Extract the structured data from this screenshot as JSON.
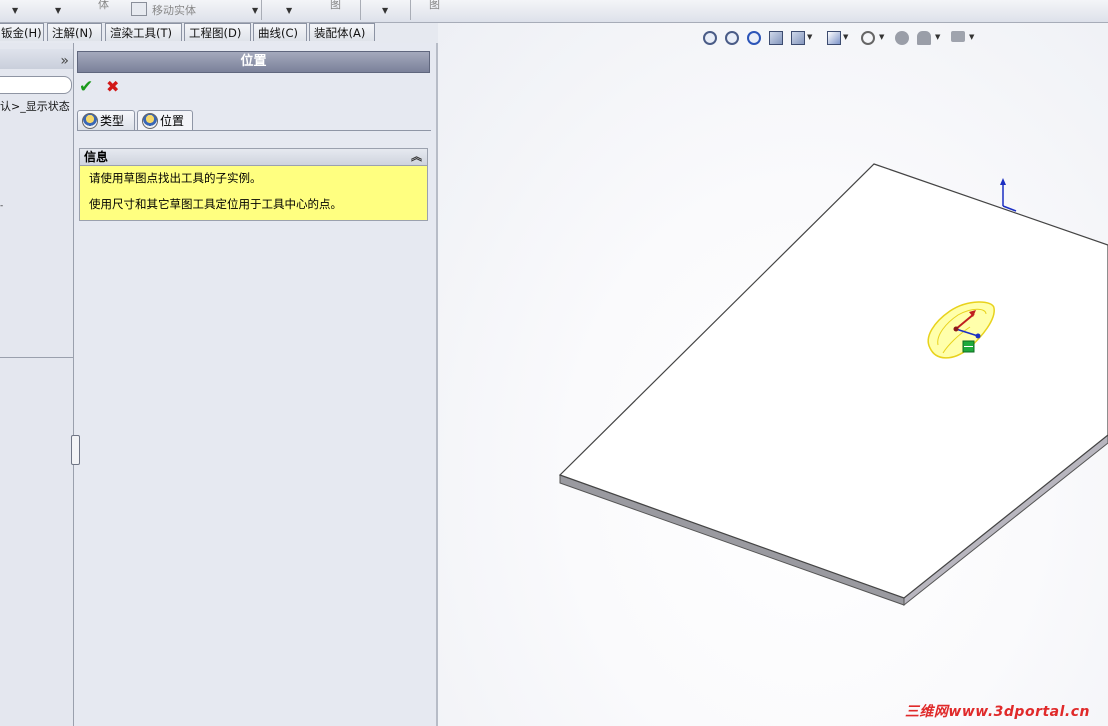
{
  "toolbar": {
    "body_label": "体",
    "move_body_label": "移动实体",
    "image_label": "图"
  },
  "command_tabs": [
    "钣金(H)",
    "注解(N)",
    "渲染工具(T)",
    "工程图(D)",
    "曲线(C)",
    "装配体(A)"
  ],
  "feature_tree": {
    "expand_chevron": "»",
    "config_text": "认>_显示状态",
    "dash": "-"
  },
  "property_manager": {
    "title": "位置",
    "ok_symbol": "✔",
    "cancel_symbol": "✖",
    "tabs": [
      {
        "label": "类型",
        "icon": "hole-wizard-icon",
        "active": false
      },
      {
        "label": "位置",
        "icon": "hole-wizard-icon",
        "active": true
      }
    ],
    "info_group": {
      "header": "信息",
      "collapse_symbol": "︽",
      "bg_color": "#ffff80",
      "lines": [
        "请使用草图点找出工具的子实例。",
        "使用尺寸和其它草图工具定位用于工具中心的点。"
      ]
    }
  },
  "view_toolbar": {
    "icons": [
      "zoom-to-fit-icon",
      "zoom-to-area-icon",
      "previous-view-icon",
      "section-view-icon",
      "view-orientation-icon",
      "display-style-icon",
      "hide-show-items-icon",
      "edit-appearance-icon",
      "apply-scene-icon",
      "view-settings-icon"
    ]
  },
  "watermark": "三维网www.3dportal.cn",
  "colors": {
    "accent": "#7b819a",
    "tool_preview": "#ffff66",
    "triad_x": "#c01f1f",
    "triad_y": "#1b2fc2",
    "sketch_point": "#1faa3c"
  }
}
